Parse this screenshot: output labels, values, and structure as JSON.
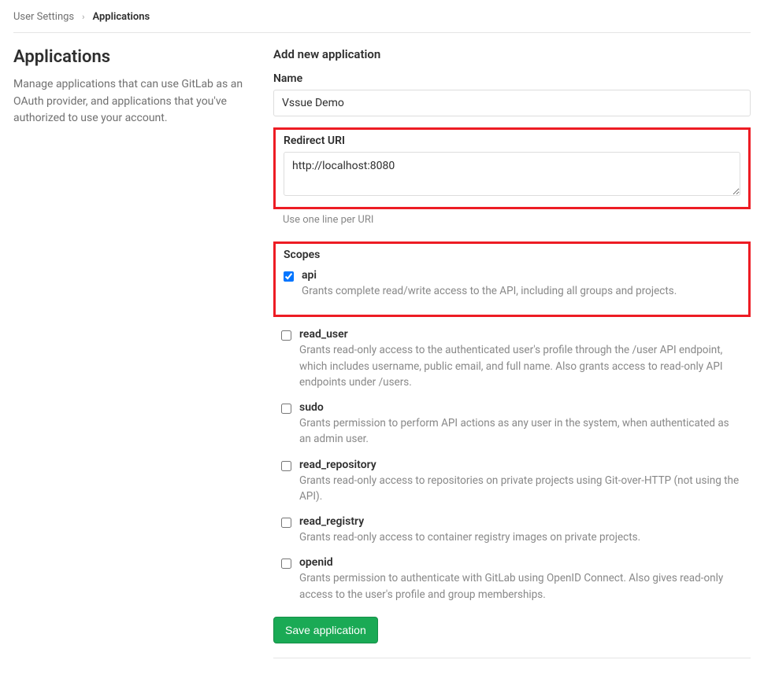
{
  "breadcrumb": {
    "parent": "User Settings",
    "current": "Applications"
  },
  "sidebar": {
    "heading": "Applications",
    "description": "Manage applications that can use GitLab as an OAuth provider, and applications that you've authorized to use your account."
  },
  "form": {
    "section_title": "Add new application",
    "name": {
      "label": "Name",
      "value": "Vssue Demo"
    },
    "redirect_uri": {
      "label": "Redirect URI",
      "value": "http://localhost:8080",
      "help": "Use one line per URI"
    },
    "scopes_label": "Scopes",
    "scopes": [
      {
        "name": "api",
        "checked": true,
        "description": "Grants complete read/write access to the API, including all groups and projects."
      },
      {
        "name": "read_user",
        "checked": false,
        "description": "Grants read-only access to the authenticated user's profile through the /user API endpoint, which includes username, public email, and full name. Also grants access to read-only API endpoints under /users."
      },
      {
        "name": "sudo",
        "checked": false,
        "description": "Grants permission to perform API actions as any user in the system, when authenticated as an admin user."
      },
      {
        "name": "read_repository",
        "checked": false,
        "description": "Grants read-only access to repositories on private projects using Git-over-HTTP (not using the API)."
      },
      {
        "name": "read_registry",
        "checked": false,
        "description": "Grants read-only access to container registry images on private projects."
      },
      {
        "name": "openid",
        "checked": false,
        "description": "Grants permission to authenticate with GitLab using OpenID Connect. Also gives read-only access to the user's profile and group memberships."
      }
    ],
    "save_button": "Save application"
  }
}
